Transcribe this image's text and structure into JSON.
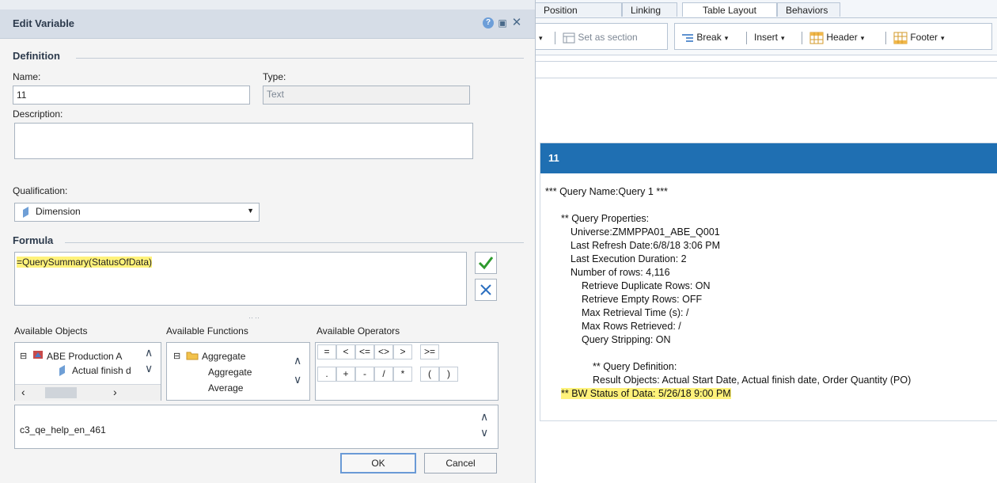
{
  "tabs": {
    "position": "Position",
    "linking": "Linking",
    "table_layout": "Table Layout",
    "behaviors": "Behaviors"
  },
  "toolbar": {
    "set_as_section": "Set as section",
    "break": "Break",
    "insert": "Insert",
    "header": "Header",
    "footer": "Footer"
  },
  "table_cell": {
    "header": "11",
    "lines": [
      "*** Query Name:Query 1 ***",
      "** Query Properties:",
      "Universe:ZMMPPA01_ABE_Q001",
      "Last Refresh Date:6/8/18 3:06 PM",
      "Last Execution Duration: 2",
      "Number of rows: 4,116",
      "Retrieve Duplicate Rows: ON",
      "Retrieve Empty Rows: OFF",
      "Max Retrieval Time (s): /",
      "Max Rows Retrieved: /",
      "Query Stripping: ON",
      "** Query Definition:",
      "Result Objects: Actual Start Date, Actual finish date, Order Quantity (PO)",
      "** BW Status of Data: 5/26/18 9:00 PM"
    ]
  },
  "dialog": {
    "title": "Edit Variable",
    "definition_label": "Definition",
    "name_label": "Name:",
    "name_value": "11",
    "type_label": "Type:",
    "type_value": "Text",
    "description_label": "Description:",
    "description_value": "",
    "qualification_label": "Qualification:",
    "qualification_value": "Dimension",
    "formula_label": "Formula",
    "formula_value": "=QuerySummary(StatusOfData)",
    "available_objects_label": "Available Objects",
    "available_functions_label": "Available Functions",
    "available_operators_label": "Available Operators",
    "objects": [
      "ABE Production A",
      "Actual finish d"
    ],
    "functions": [
      "Aggregate",
      "Aggregate",
      "Average"
    ],
    "operators_row1": [
      "=",
      "<",
      "<=",
      "<>",
      ">",
      ">="
    ],
    "operators_row2": [
      ".",
      "+",
      "-",
      "/",
      "*",
      "(",
      ")"
    ],
    "help_text": "c3_qe_help_en_461",
    "ok": "OK",
    "cancel": "Cancel"
  },
  "colors": {
    "header_blue": "#1f6fb2",
    "highlight": "#fff27a",
    "validate_green": "#2e9a2e",
    "clear_blue": "#2b6fc0"
  }
}
